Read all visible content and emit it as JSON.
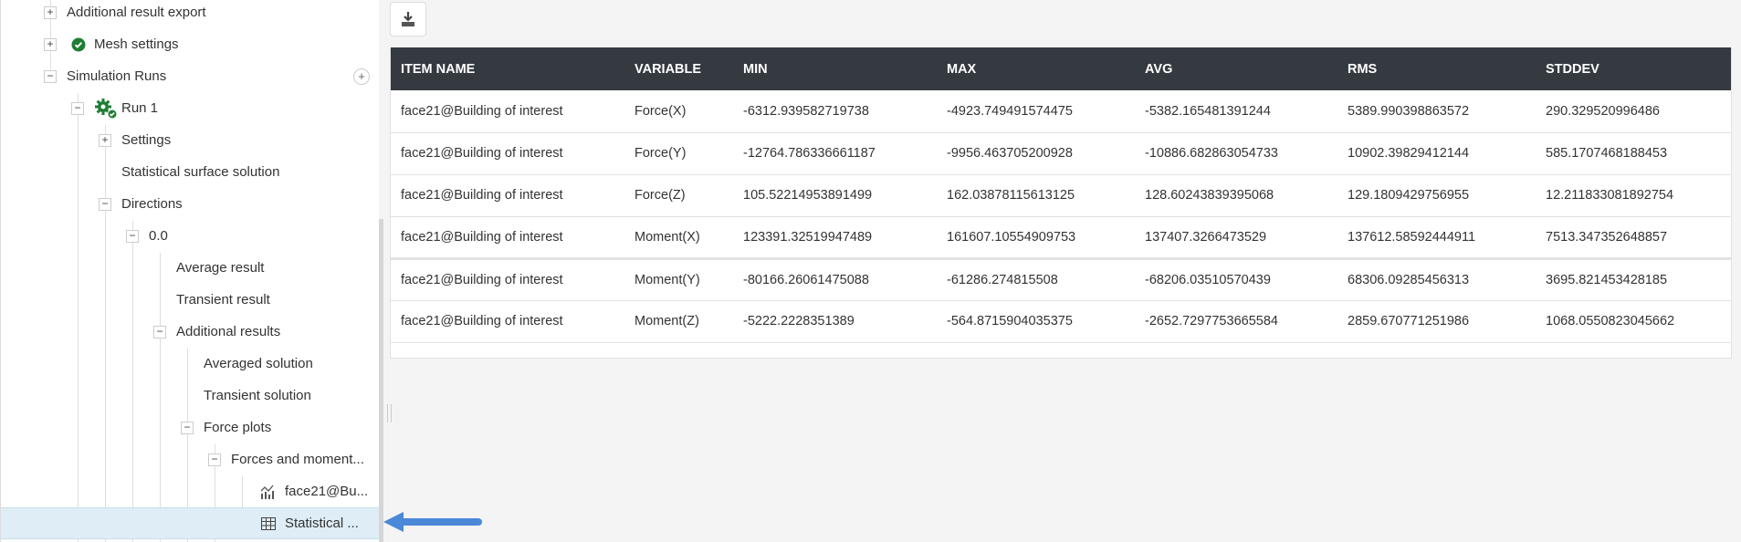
{
  "tree": {
    "items": [
      {
        "label": "Additional result export",
        "toggle": "+"
      },
      {
        "label": "Mesh settings",
        "toggle": "+"
      },
      {
        "label": "Simulation Runs",
        "toggle": "−",
        "action": "+"
      },
      {
        "label": "Run 1",
        "toggle": "−"
      },
      {
        "label": "Settings",
        "toggle": "+"
      },
      {
        "label": "Statistical surface solution"
      },
      {
        "label": "Directions",
        "toggle": "−"
      },
      {
        "label": "0.0",
        "toggle": "−"
      },
      {
        "label": "Average result"
      },
      {
        "label": "Transient result"
      },
      {
        "label": "Additional results",
        "toggle": "−"
      },
      {
        "label": "Averaged solution"
      },
      {
        "label": "Transient solution"
      },
      {
        "label": "Force plots",
        "toggle": "−"
      },
      {
        "label": "Forces and moment...",
        "toggle": "−"
      },
      {
        "label": "face21@Bu..."
      },
      {
        "label": "Statistical ..."
      }
    ]
  },
  "colors": {
    "header_bg": "#353a41",
    "selected_bg": "#deedf6",
    "success": "#1e7e34",
    "arrow": "#4a88d8"
  },
  "table": {
    "headers": [
      "ITEM NAME",
      "VARIABLE",
      "MIN",
      "MAX",
      "AVG",
      "RMS",
      "STDDEV"
    ],
    "rows": [
      [
        "face21@Building of interest",
        "Force(X)",
        "-6312.939582719738",
        "-4923.749491574475",
        "-5382.165481391244",
        "5389.990398863572",
        "290.329520996486"
      ],
      [
        "face21@Building of interest",
        "Force(Y)",
        "-12764.786336661187",
        "-9956.463705200928",
        "-10886.682863054733",
        "10902.39829412144",
        "585.1707468188453"
      ],
      [
        "face21@Building of interest",
        "Force(Z)",
        "105.52214953891499",
        "162.03878115613125",
        "128.60243839395068",
        "129.1809429756955",
        "12.211833081892754"
      ],
      [
        "face21@Building of interest",
        "Moment(X)",
        "123391.32519947489",
        "161607.10554909753",
        "137407.3266473529",
        "137612.58592444911",
        "7513.347352648857"
      ],
      [
        "face21@Building of interest",
        "Moment(Y)",
        "-80166.26061475088",
        "-61286.274815508",
        "-68206.03510570439",
        "68306.09285456313",
        "3695.821453428185"
      ],
      [
        "face21@Building of interest",
        "Moment(Z)",
        "-5222.2228351389",
        "-564.8715904035375",
        "-2652.7297753665584",
        "2859.670771251986",
        "1068.0550823045662"
      ]
    ]
  }
}
